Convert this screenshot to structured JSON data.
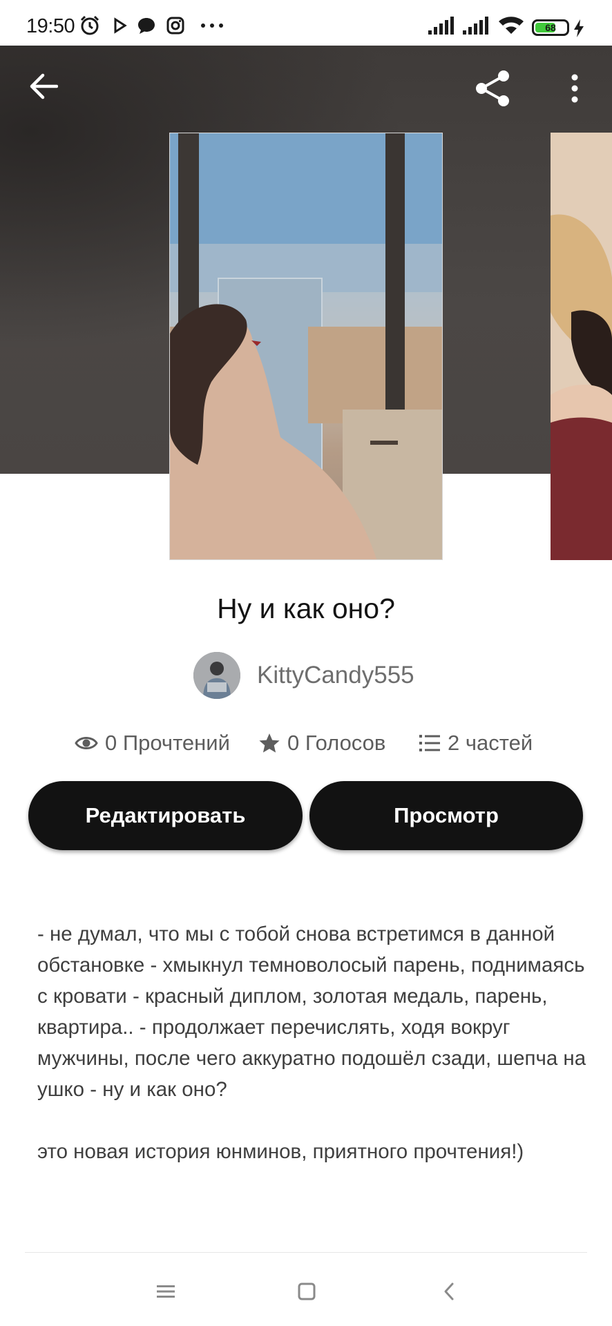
{
  "status_bar": {
    "time": "19:50",
    "battery_percent": "68",
    "battery_level": 0.68,
    "icons": [
      "alarm-icon",
      "play-icon",
      "chat-bubble-icon",
      "instagram-icon",
      "more-dots-icon",
      "signal-icon",
      "signal-icon",
      "wifi-icon",
      "battery-icon",
      "charging-icon"
    ]
  },
  "toolbar": {
    "back_icon": "arrow-left-icon",
    "share_icon": "share-icon",
    "menu_icon": "more-vertical-icon"
  },
  "story": {
    "title": "Ну и как оно?",
    "author": "KittyCandy555",
    "stats": {
      "reads": "0 Прочтений",
      "votes": "0 Голосов",
      "parts": "2 частей"
    },
    "buttons": {
      "edit": "Редактировать",
      "view": "Просмотр"
    },
    "description": [
      "- не думал, что мы с тобой снова встретимся в данной обстановке - хмыкнул темноволосый парень, поднимаясь с кровати - красный диплом, золотая медаль, парень, квартира.. - продолжает перечислять, ходя вокруг мужчины, после чего аккуратно подошёл сзади, шепча на ушко - ну и как оно?",
      "это новая история юнминов, приятного прочтения!)"
    ]
  },
  "colors": {
    "hero_background": "#4a4644",
    "button_background": "#121212",
    "button_text": "#ffffff",
    "battery_fill": "#41c93b"
  },
  "nav_bar": {
    "icons": [
      "menu-icon",
      "home-square-icon",
      "back-chevron-icon"
    ]
  }
}
